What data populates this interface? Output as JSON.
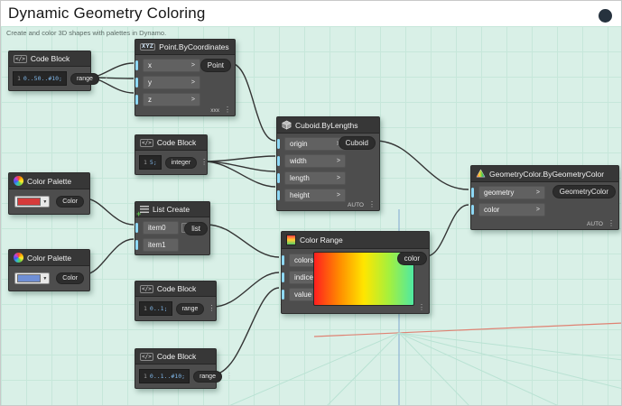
{
  "header": {
    "title": "Dynamic Geometry Coloring",
    "subtitle": "Create and color 3D shapes with palettes in Dynamo."
  },
  "ui": {
    "chevron": ">",
    "menu": "⋮",
    "codeIcon": "</>",
    "ddArrow": "▼"
  },
  "colors": {
    "canvas": "#d9f0e7",
    "nodeBody": "#4d4d4d",
    "nodeHeader": "#373737",
    "portAccent": "#8ed9f6",
    "paletteSwatch1": "#d63a3a",
    "paletteSwatch2": "#6f8fd6",
    "axisRed": "#df8273",
    "axisBlue": "#90b4d4"
  },
  "nodes": {
    "codeBlock1": {
      "title": "Code Block",
      "lineNo": "1",
      "code": "0..50..#10;",
      "output": "range"
    },
    "point": {
      "title": "Point.ByCoordinates",
      "iconLabel": "XYZ",
      "inputs": [
        "x",
        "y",
        "z"
      ],
      "output": "Point",
      "lacing": "xxx"
    },
    "codeBlock2": {
      "title": "Code Block",
      "lineNo": "1",
      "code": "5;",
      "output": "integer"
    },
    "cuboid": {
      "title": "Cuboid.ByLengths",
      "inputs": [
        "origin",
        "width",
        "length",
        "height"
      ],
      "output": "Cuboid",
      "lacing": "AUTO"
    },
    "palette1": {
      "title": "Color Palette",
      "output": "Color"
    },
    "palette2": {
      "title": "Color Palette",
      "output": "Color"
    },
    "listCreate": {
      "title": "List Create",
      "inputs": [
        "item0",
        "item1"
      ],
      "output": "list",
      "add": "+",
      "remove": "−"
    },
    "colorRange": {
      "title": "Color Range",
      "inputs": [
        "colors",
        "indices",
        "value"
      ],
      "output": "color"
    },
    "codeBlock3": {
      "title": "Code Block",
      "lineNo": "1",
      "code": "0..1;",
      "output": "range"
    },
    "codeBlock4": {
      "title": "Code Block",
      "lineNo": "1",
      "code": "0..1..#10;",
      "output": "range"
    },
    "geometryColor": {
      "title": "GeometryColor.ByGeometryColor",
      "inputs": [
        "geometry",
        "color"
      ],
      "output": "GeometryColor",
      "lacing": "AUTO"
    }
  }
}
